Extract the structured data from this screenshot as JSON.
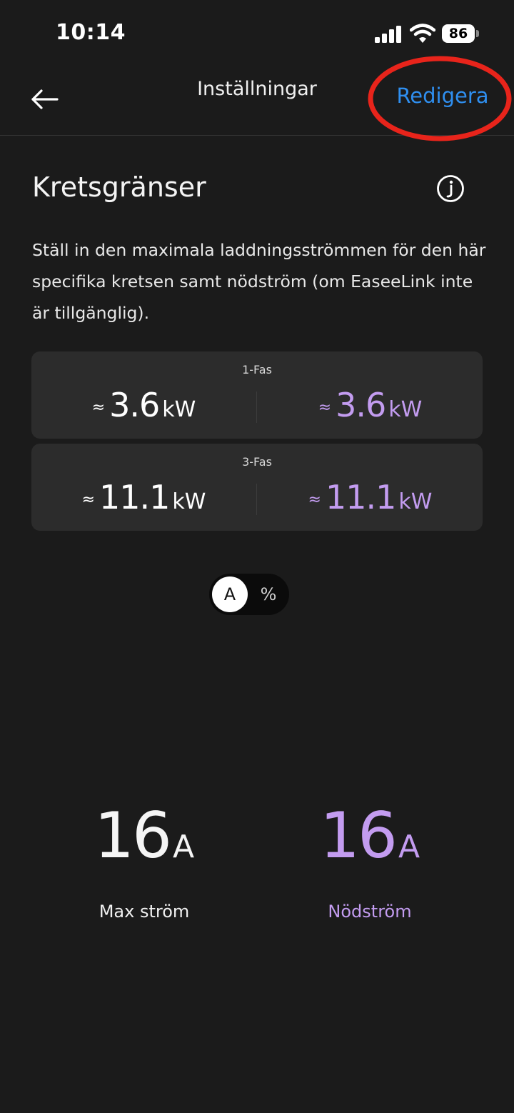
{
  "status_bar": {
    "time": "10:14",
    "battery": "86",
    "signal_icon": "cellular-signal-icon",
    "wifi_icon": "wifi-icon"
  },
  "nav": {
    "title": "Inställningar",
    "edit_label": "Redigera",
    "back_icon": "arrow-left-icon"
  },
  "section": {
    "title": "Kretsgränser",
    "info_icon": "info-icon",
    "description": "Ställ in den maximala laddningsströmmen för den här specifika kretsen samt nödström (om EaseeLink inte är tillgänglig)."
  },
  "phases": [
    {
      "label": "1-Fas",
      "left": {
        "approx": "≈",
        "value": "3.6",
        "unit": "kW"
      },
      "right": {
        "approx": "≈",
        "value": "3.6",
        "unit": "kW"
      }
    },
    {
      "label": "3-Fas",
      "left": {
        "approx": "≈",
        "value": "11.1",
        "unit": "kW"
      },
      "right": {
        "approx": "≈",
        "value": "11.1",
        "unit": "kW"
      }
    }
  ],
  "unit_toggle": {
    "selected": "A",
    "other": "%"
  },
  "limits": {
    "max": {
      "value": "16",
      "unit": "A",
      "label": "Max ström"
    },
    "emergency": {
      "value": "16",
      "unit": "A",
      "label": "Nödström"
    }
  },
  "colors": {
    "background": "#1b1b1b",
    "card": "#2c2c2c",
    "accent_blue": "#2f8ff0",
    "accent_purple": "#c39cf0",
    "annotation_red": "#e8241b"
  }
}
